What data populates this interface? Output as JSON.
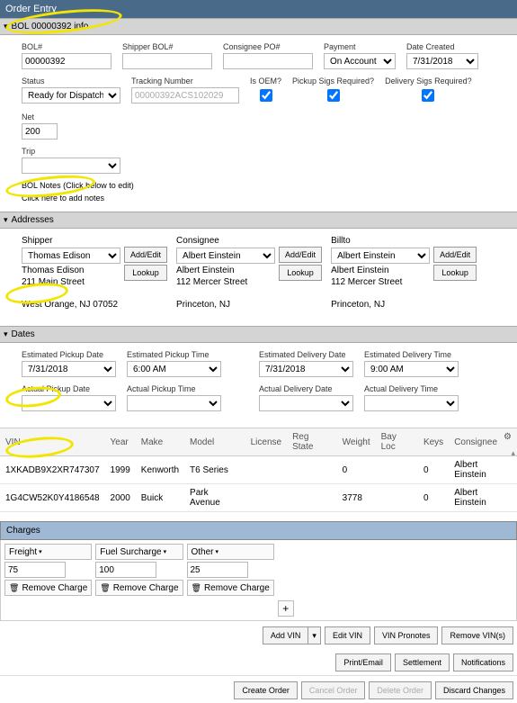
{
  "header": {
    "title": "Order Entry"
  },
  "bol": {
    "section": "BOL 00000392 info",
    "bol_num_label": "BOL#",
    "bol_num": "00000392",
    "shipper_bol_label": "Shipper BOL#",
    "shipper_bol": "",
    "consignee_po_label": "Consignee PO#",
    "consignee_po": "",
    "payment_label": "Payment",
    "payment": "On Account",
    "date_created_label": "Date Created",
    "date_created": "7/31/2018",
    "status_label": "Status",
    "status": "Ready for Dispatch",
    "tracking_label": "Tracking Number",
    "tracking": "00000392ACS102029",
    "is_oem_label": "Is OEM?",
    "is_oem": true,
    "pickup_sigs_label": "Pickup Sigs Required?",
    "pickup_sigs": true,
    "delivery_sigs_label": "Delivery Sigs Required?",
    "delivery_sigs": true,
    "net_label": "Net",
    "net": "200",
    "trip_label": "Trip",
    "trip": "",
    "notes_label": "BOL Notes (Click below to edit)",
    "notes_placeholder": "Click here to add notes"
  },
  "addresses": {
    "section": "Addresses",
    "shipper_label": "Shipper",
    "shipper": "Thomas Edison",
    "shipper_name": "Thomas Edison",
    "shipper_street": "211 Main Street",
    "shipper_city": "West Orange, NJ 07052",
    "consignee_label": "Consignee",
    "consignee": "Albert Einstein",
    "consignee_name": "Albert Einstein",
    "consignee_street": "112 Mercer Street",
    "consignee_city": "Princeton, NJ",
    "billto_label": "Billto",
    "billto": "Albert Einstein",
    "billto_name": "Albert Einstein",
    "billto_street": "112 Mercer Street",
    "billto_city": "Princeton, NJ",
    "add_edit": "Add/Edit",
    "lookup": "Lookup"
  },
  "dates": {
    "section": "Dates",
    "est_pickup_date_label": "Estimated Pickup Date",
    "est_pickup_date": "7/31/2018",
    "est_pickup_time_label": "Estimated Pickup Time",
    "est_pickup_time": "6:00 AM",
    "est_delivery_date_label": "Estimated Delivery Date",
    "est_delivery_date": "7/31/2018",
    "est_delivery_time_label": "Estimated Delivery Time",
    "est_delivery_time": "9:00 AM",
    "act_pickup_date_label": "Actual Pickup Date",
    "act_pickup_date": "",
    "act_pickup_time_label": "Actual Pickup Time",
    "act_pickup_time": "",
    "act_delivery_date_label": "Actual Delivery Date",
    "act_delivery_date": "",
    "act_delivery_time_label": "Actual Delivery Time",
    "act_delivery_time": ""
  },
  "vins": {
    "headers": {
      "vin": "VIN",
      "year": "Year",
      "make": "Make",
      "model": "Model",
      "license": "License",
      "regstate": "Reg State",
      "weight": "Weight",
      "bayloc": "Bay Loc",
      "keys": "Keys",
      "consignee": "Consignee"
    },
    "rows": [
      {
        "vin": "1XKADB9X2XR747307",
        "year": "1999",
        "make": "Kenworth",
        "model": "T6 Series",
        "license": "",
        "regstate": "",
        "weight": "0",
        "bayloc": "",
        "keys": "0",
        "consignee": "Albert Einstein"
      },
      {
        "vin": "1G4CW52K0Y4186548",
        "year": "2000",
        "make": "Buick",
        "model": "Park Avenue",
        "license": "",
        "regstate": "",
        "weight": "3778",
        "bayloc": "",
        "keys": "0",
        "consignee": "Albert Einstein"
      }
    ]
  },
  "charges": {
    "section": "Charges",
    "items": [
      {
        "name": "Freight",
        "value": "75"
      },
      {
        "name": "Fuel Surcharge",
        "value": "100"
      },
      {
        "name": "Other",
        "value": "25"
      }
    ],
    "remove": "Remove Charge",
    "add": "+"
  },
  "actions": {
    "add_vin": "Add VIN",
    "edit_vin": "Edit VIN",
    "vin_pronotes": "VIN Pronotes",
    "remove_vins": "Remove VIN(s)",
    "print_email": "Print/Email",
    "settlement": "Settlement",
    "notifications": "Notifications",
    "create_order": "Create Order",
    "cancel_order": "Cancel Order",
    "delete_order": "Delete Order",
    "discard": "Discard Changes"
  }
}
